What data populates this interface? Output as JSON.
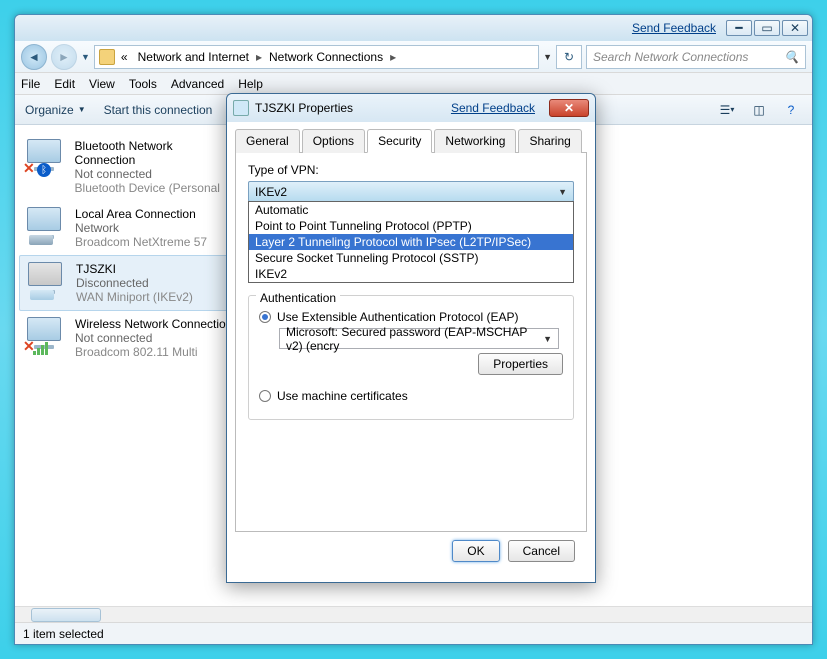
{
  "titlebar": {
    "feedback": "Send Feedback"
  },
  "nav": {
    "chevrons": "«",
    "crumb1": "Network and Internet",
    "crumb2": "Network Connections",
    "search_placeholder": "Search Network Connections"
  },
  "menu": {
    "file": "File",
    "edit": "Edit",
    "view": "View",
    "tools": "Tools",
    "advanced": "Advanced",
    "help": "Help"
  },
  "cmdbar": {
    "organize": "Organize",
    "start": "Start this connection"
  },
  "connections": [
    {
      "name": "Bluetooth Network Connection",
      "status": "Not connected",
      "device": "Bluetooth Device (Personal"
    },
    {
      "name": "Local Area Connection",
      "status": "Network",
      "device": "Broadcom NetXtreme 57"
    },
    {
      "name": "TJSZKI",
      "status": "Disconnected",
      "device": "WAN Miniport (IKEv2)"
    },
    {
      "name": "Wireless Network Connection",
      "status": "Not connected",
      "device": "Broadcom 802.11 Multi"
    }
  ],
  "status": "1 item selected",
  "dialog": {
    "title": "TJSZKI Properties",
    "feedback": "Send Feedback",
    "tabs": {
      "general": "General",
      "options": "Options",
      "security": "Security",
      "networking": "Networking",
      "sharing": "Sharing"
    },
    "type_label": "Type of VPN:",
    "combo_value": "IKEv2",
    "options": [
      "Automatic",
      "Point to Point Tunneling Protocol (PPTP)",
      "Layer 2 Tunneling Protocol with IPsec (L2TP/IPSec)",
      "Secure Socket Tunneling Protocol (SSTP)",
      "IKEv2"
    ],
    "auth_label": "Authentication",
    "eap_label": "Use Extensible Authentication Protocol (EAP)",
    "eap_method": "Microsoft: Secured password (EAP-MSCHAP v2) (encry",
    "properties_btn": "Properties",
    "cert_label": "Use machine certificates",
    "ok": "OK",
    "cancel": "Cancel"
  }
}
